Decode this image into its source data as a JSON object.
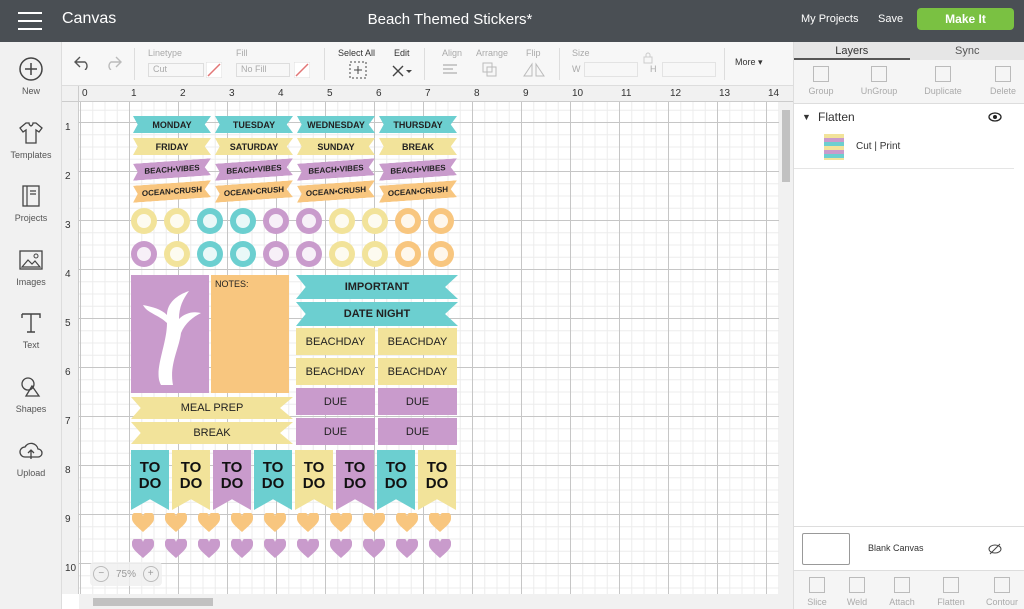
{
  "header": {
    "app_title": "Canvas",
    "doc_title": "Beach Themed Stickers*",
    "my_projects": "My Projects",
    "save": "Save",
    "make_it": "Make It"
  },
  "leftbar": {
    "items": [
      {
        "label": "New",
        "icon": "plus-circle-icon"
      },
      {
        "label": "Templates",
        "icon": "shirt-icon"
      },
      {
        "label": "Projects",
        "icon": "book-icon"
      },
      {
        "label": "Images",
        "icon": "image-icon"
      },
      {
        "label": "Text",
        "icon": "text-icon"
      },
      {
        "label": "Shapes",
        "icon": "shapes-icon"
      },
      {
        "label": "Upload",
        "icon": "cloud-upload-icon"
      }
    ]
  },
  "toolbar": {
    "linetype_label": "Linetype",
    "linetype_value": "Cut",
    "fill_label": "Fill",
    "fill_value": "No Fill",
    "select_all": "Select All",
    "edit": "Edit",
    "align": "Align",
    "arrange": "Arrange",
    "flip": "Flip",
    "size": "Size",
    "w": "W",
    "h": "H",
    "more": "More"
  },
  "ruler": {
    "top": [
      "0",
      "1",
      "2",
      "3",
      "4",
      "5",
      "6",
      "7",
      "8",
      "9",
      "10",
      "11",
      "12",
      "13",
      "14"
    ],
    "left": [
      "1",
      "2",
      "3",
      "4",
      "5",
      "6",
      "7",
      "8",
      "9",
      "10"
    ]
  },
  "zoom": {
    "value": "75%",
    "minus": "−",
    "plus": "+"
  },
  "panel": {
    "tabs": [
      "Layers",
      "Sync"
    ],
    "actions": [
      "Group",
      "UnGroup",
      "Duplicate",
      "Delete"
    ],
    "layer_group_name": "Flatten",
    "layer_item": "Cut  |  Print",
    "blank_canvas": "Blank Canvas",
    "bottom_actions": [
      "Slice",
      "Weld",
      "Attach",
      "Flatten",
      "Contour"
    ]
  },
  "stickers": {
    "days": [
      "MONDAY",
      "TUESDAY",
      "WEDNESDAY",
      "THURSDAY",
      "FRIDAY",
      "SATURDAY",
      "SUNDAY",
      "BREAK"
    ],
    "vibes": "BEACH•VIBES",
    "crush": "OCEAN•CRUSH",
    "notes": "NOTES:",
    "important": "IMPORTANT",
    "date_night": "DATE NIGHT",
    "beachday": "BEACHDAY",
    "due": "DUE",
    "meal_prep": "MEAL PREP",
    "break": "BREAK",
    "todo": "TO DO"
  },
  "colors": {
    "teal": "#6ccfd0",
    "yellow": "#f2e39a",
    "purple": "#c99bcc",
    "orange": "#f8c67f",
    "accent": "#7ac142",
    "topbar": "#4a4f54"
  }
}
